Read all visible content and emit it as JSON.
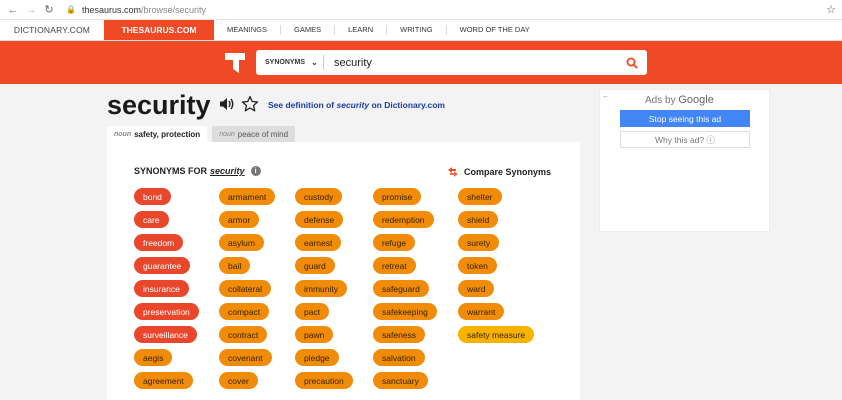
{
  "browser": {
    "domain": "thesaurus.com",
    "path": "/browse/security"
  },
  "site_nav": {
    "dictionary": "DICTIONARY.COM",
    "thesaurus": "THESAURUS.COM",
    "links": [
      "MEANINGS",
      "GAMES",
      "LEARN",
      "WRITING",
      "WORD OF THE DAY"
    ]
  },
  "search": {
    "type_label": "SYNONYMS",
    "value": "security"
  },
  "entry": {
    "word": "security",
    "def_prefix": "See definition of ",
    "def_word": "security",
    "def_suffix": " on Dictionary.com",
    "tabs": [
      {
        "pos": "noun",
        "label": "safety, protection"
      },
      {
        "pos": "noun",
        "label": "peace of mind"
      }
    ]
  },
  "synonyms": {
    "heading": "SYNONYMS FOR",
    "word": "security",
    "compare_label": "Compare Synonyms",
    "columns": [
      [
        {
          "w": "bond",
          "tone": "red"
        },
        {
          "w": "care",
          "tone": "red"
        },
        {
          "w": "freedom",
          "tone": "red"
        },
        {
          "w": "guarantee",
          "tone": "red"
        },
        {
          "w": "insurance",
          "tone": "red"
        },
        {
          "w": "preservation",
          "tone": "red"
        },
        {
          "w": "surveillance",
          "tone": "red"
        },
        {
          "w": "aegis",
          "tone": "orange"
        },
        {
          "w": "agreement",
          "tone": "orange"
        }
      ],
      [
        {
          "w": "armament",
          "tone": "orange"
        },
        {
          "w": "armor",
          "tone": "orange"
        },
        {
          "w": "asylum",
          "tone": "orange"
        },
        {
          "w": "bail",
          "tone": "orange"
        },
        {
          "w": "collateral",
          "tone": "orange"
        },
        {
          "w": "compact",
          "tone": "orange"
        },
        {
          "w": "contract",
          "tone": "orange"
        },
        {
          "w": "covenant",
          "tone": "orange"
        },
        {
          "w": "cover",
          "tone": "orange"
        }
      ],
      [
        {
          "w": "custody",
          "tone": "orange"
        },
        {
          "w": "defense",
          "tone": "orange"
        },
        {
          "w": "earnest",
          "tone": "orange"
        },
        {
          "w": "guard",
          "tone": "orange"
        },
        {
          "w": "immunity",
          "tone": "orange"
        },
        {
          "w": "pact",
          "tone": "orange"
        },
        {
          "w": "pawn",
          "tone": "orange"
        },
        {
          "w": "pledge",
          "tone": "orange"
        },
        {
          "w": "precaution",
          "tone": "orange"
        }
      ],
      [
        {
          "w": "promise",
          "tone": "orange"
        },
        {
          "w": "redemption",
          "tone": "orange"
        },
        {
          "w": "refuge",
          "tone": "orange"
        },
        {
          "w": "retreat",
          "tone": "orange"
        },
        {
          "w": "safeguard",
          "tone": "orange"
        },
        {
          "w": "safekeeping",
          "tone": "orange"
        },
        {
          "w": "safeness",
          "tone": "orange"
        },
        {
          "w": "salvation",
          "tone": "orange"
        },
        {
          "w": "sanctuary",
          "tone": "orange"
        }
      ],
      [
        {
          "w": "shelter",
          "tone": "orange"
        },
        {
          "w": "shield",
          "tone": "orange"
        },
        {
          "w": "surety",
          "tone": "orange"
        },
        {
          "w": "token",
          "tone": "orange"
        },
        {
          "w": "ward",
          "tone": "orange"
        },
        {
          "w": "warrant",
          "tone": "orange"
        },
        {
          "w": "safety measure",
          "tone": "yellow"
        }
      ]
    ]
  },
  "ad": {
    "ads_by": "Ads by",
    "brand": "Google",
    "stop": "Stop seeing this ad",
    "why": "Why this ad? ⓘ"
  },
  "colors": {
    "brand": "#ef4a25",
    "pill_red": "#e8472c",
    "pill_orange": "#f08c0a",
    "pill_yellow": "#f7b300",
    "link": "#1a3d9e"
  },
  "icons": [
    "back-arrow-icon",
    "forward-arrow-icon",
    "reload-icon",
    "lock-icon",
    "bookmark-star-icon",
    "thesaurus-logo-icon",
    "chevron-down-icon",
    "search-icon",
    "speaker-icon",
    "favorite-star-icon",
    "info-icon",
    "compare-icon"
  ]
}
